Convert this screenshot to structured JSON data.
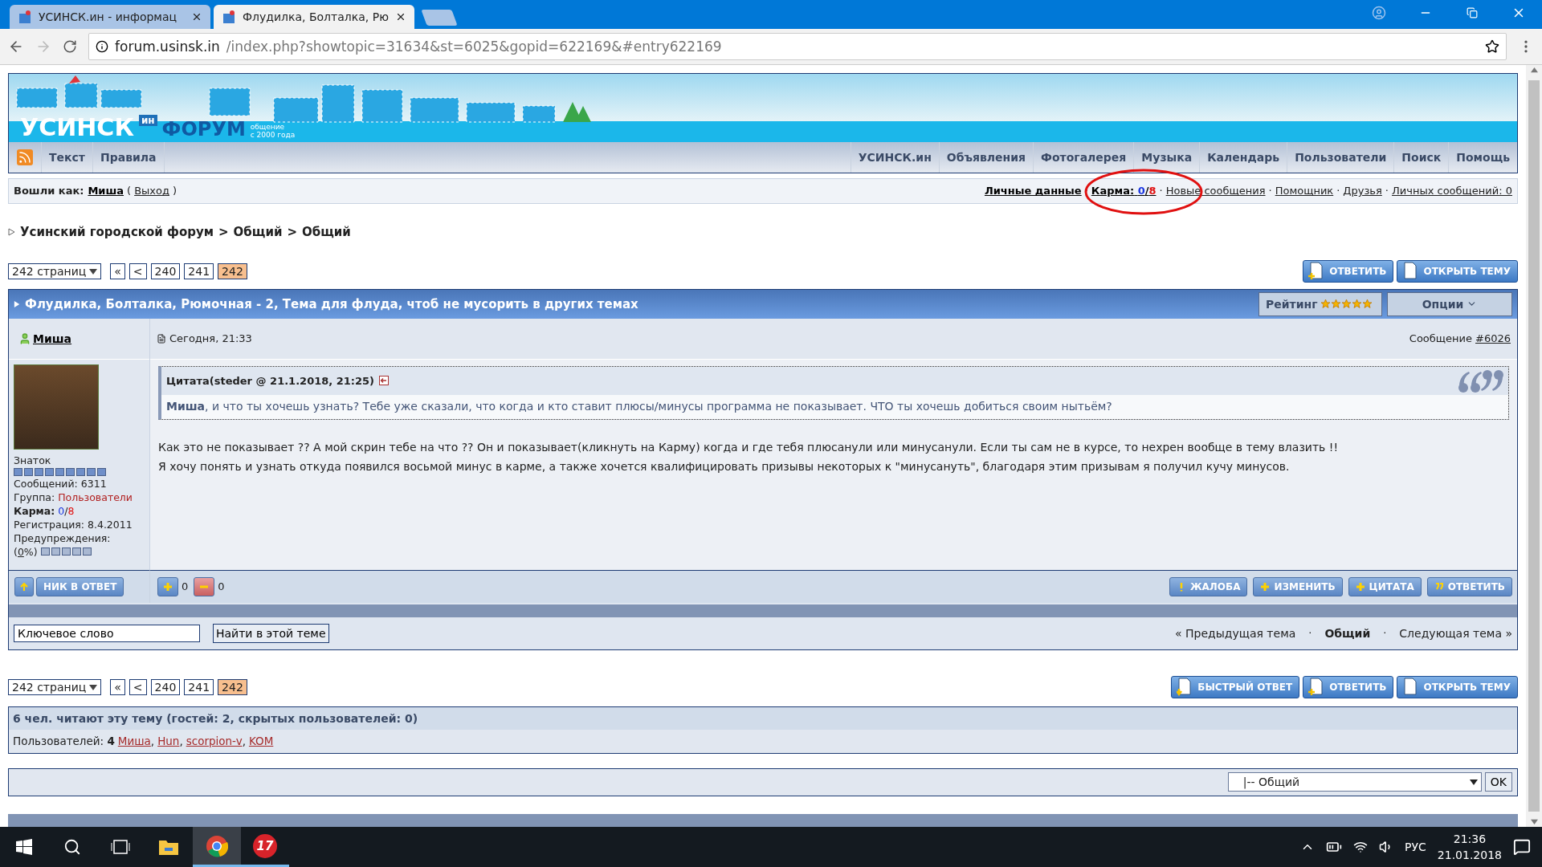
{
  "browser": {
    "tabs": [
      {
        "title": "УСИНСК.ин - информац",
        "selected": false
      },
      {
        "title": "Флудилка, Болталка, Рю",
        "selected": true
      }
    ],
    "address": {
      "domain": "forum.usinsk.in",
      "path": "/index.php?showtopic=31634&st=6025&gopid=622169&#entry622169"
    }
  },
  "banner": {
    "logo": "УСИНСК",
    "logo_sup": "ин",
    "forum": "ФОРУМ",
    "tagline": "общение",
    "tagline2": "с 2000 года"
  },
  "nav": {
    "left": [
      "Текст",
      "Правила"
    ],
    "right": [
      "УСИНСК.ин",
      "Объявления",
      "Фотогалерея",
      "Музыка",
      "Календарь",
      "Пользователи",
      "Поиск",
      "Помощь"
    ]
  },
  "user_bar": {
    "prefix": "Вошли как:",
    "user": "Миша",
    "paren_open": "(",
    "logout": "Выход",
    "paren_close": ")",
    "separator": "·",
    "links": [
      {
        "kind": "bold",
        "text": "Личные данные"
      },
      {
        "kind": "karma",
        "label": "Карма:",
        "plus": "0",
        "slash": "/",
        "minus": "8"
      },
      {
        "kind": "link",
        "text": "Новые сообщения"
      },
      {
        "kind": "link",
        "text": "Помощник"
      },
      {
        "kind": "link",
        "text": "Друзья"
      },
      {
        "kind": "link",
        "text": "Личных сообщений: 0"
      }
    ]
  },
  "breadcrumb": {
    "items": [
      "Усинский городской форум",
      "Общий",
      "Общий"
    ],
    "separator": ">"
  },
  "pagination_top": {
    "pages_label": "242 страниц",
    "first": "«",
    "prev": "<",
    "pages": [
      {
        "label": "240",
        "selected": false
      },
      {
        "label": "241",
        "selected": false
      },
      {
        "label": "242",
        "selected": true
      }
    ]
  },
  "buttons_top": [
    {
      "kind": "reply",
      "label": "ОТВЕТИТЬ"
    },
    {
      "kind": "new",
      "label": "ОТКРЫТЬ ТЕМУ"
    }
  ],
  "topic": {
    "title": "Флудилка, Болталка, Рюмочная - 2, Тема для флуда, чтоб не мусорить в других темах",
    "rating_label": "Рейтинг",
    "stars": 5,
    "options": "Опции"
  },
  "post": {
    "author": "Миша",
    "date": "Сегодня, 21:33",
    "message_label": "Сообщение",
    "message_link": "#6026",
    "rank": "Знаток",
    "posts": "Сообщений: 6311",
    "group_label": "Группа:",
    "group": "Пользователи",
    "karma_label": "Карма:",
    "karma_plus": "0",
    "karma_slash": "/",
    "karma_minus": "8",
    "registered": "Регистрация: 8.4.2011",
    "warnings": "Предупреждения:",
    "warn_open": "(",
    "warn_value": "0",
    "warn_close": "%)",
    "quote_header": "Цитата(steder @ 21.1.2018, 21:25)",
    "quote_text": "**Миша**, и что ты хочешь узнать? Тебе уже сказали, что когда и кто ставит плюсы/минусы программа не показывает. ЧТО ты хочешь добиться своим нытьём?",
    "body": [
      "Как это не показывает ?? А мой скрин тебе на что ?? Он и показывает(кликнуть на Карму) когда и где тебя плюсанули или минусанули. Если ты сам не в курсе, то нехрен вообще в тему влазить !!",
      "Я хочу понять и узнать откуда появился восьмой минус в карме, а также хочется квалифицировать призывы некоторых к \"минусануть\", благодаря этим призывам я получил кучу минусов."
    ],
    "nick_button": "НИК В ОТВЕТ",
    "plus_count": "0",
    "minus_count": "0",
    "actions": [
      {
        "kind": "report",
        "label": "ЖАЛОБА"
      },
      {
        "kind": "edit",
        "label": "ИЗМЕНИТЬ"
      },
      {
        "kind": "quote",
        "label": "ЦИТАТА"
      },
      {
        "kind": "reply",
        "label": "ОТВЕТИТЬ"
      }
    ]
  },
  "search": {
    "value": "Ключевое слово",
    "button": "Найти в этой теме"
  },
  "topic_nav": {
    "prev": "« Предыдущая тема",
    "current": "Общий",
    "next": "Следующая тема »",
    "separator": "·"
  },
  "pagination_bottom": {
    "pages_label": "242 страниц",
    "first": "«",
    "prev": "<",
    "pages": [
      {
        "label": "240",
        "selected": false
      },
      {
        "label": "241",
        "selected": false
      },
      {
        "label": "242",
        "selected": true
      }
    ]
  },
  "buttons_bottom": [
    {
      "kind": "fast",
      "label": "БЫСТРЫЙ ОТВЕТ"
    },
    {
      "kind": "reply",
      "label": "ОТВЕТИТЬ"
    },
    {
      "kind": "new",
      "label": "ОТКРЫТЬ ТЕМУ"
    }
  ],
  "readers": {
    "title": "6 чел. читают эту тему (гостей: 2, скрытых пользователей: 0)",
    "label": "Пользователей:",
    "count": "4",
    "users": [
      "Миша",
      "Hun",
      "scorpion-v",
      "KOM"
    ],
    "user_separator": ","
  },
  "jump": {
    "value": "|-- Общий",
    "ok": "OK"
  },
  "taskbar": {
    "app_badge": "17",
    "lang": "РУС",
    "time": "21:36",
    "date": "21.01.2018"
  }
}
